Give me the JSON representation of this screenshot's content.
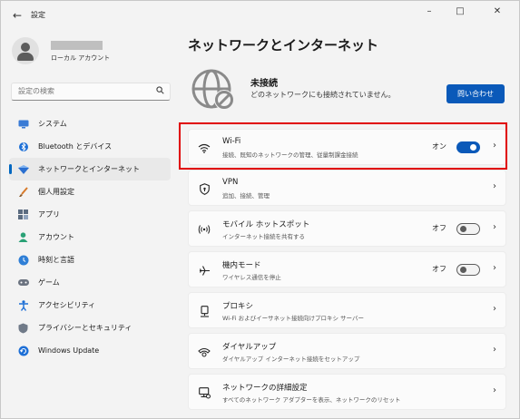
{
  "window": {
    "title": "設定",
    "back_icon": "back-arrow-icon",
    "controls": [
      "minimize",
      "maximize",
      "close"
    ]
  },
  "profile": {
    "account_type": "ローカル アカウント",
    "name_redacted": true
  },
  "search": {
    "placeholder": "設定の検索"
  },
  "sidebar": {
    "items": [
      {
        "label": "システム",
        "icon": "system-icon"
      },
      {
        "label": "Bluetooth とデバイス",
        "icon": "bluetooth-icon"
      },
      {
        "label": "ネットワークとインターネット",
        "icon": "network-icon",
        "selected": true
      },
      {
        "label": "個人用設定",
        "icon": "personalization-icon"
      },
      {
        "label": "アプリ",
        "icon": "apps-icon"
      },
      {
        "label": "アカウント",
        "icon": "account-icon"
      },
      {
        "label": "時刻と言語",
        "icon": "time-language-icon"
      },
      {
        "label": "ゲーム",
        "icon": "gaming-icon"
      },
      {
        "label": "アクセシビリティ",
        "icon": "accessibility-icon"
      },
      {
        "label": "プライバシーとセキュリティ",
        "icon": "privacy-icon"
      },
      {
        "label": "Windows Update",
        "icon": "windows-update-icon"
      }
    ]
  },
  "main": {
    "title": "ネットワークとインターネット",
    "status": {
      "title": "未接続",
      "description": "どのネットワークにも接続されていません。",
      "help_button": "問い合わせ"
    },
    "cards": [
      {
        "title": "Wi-Fi",
        "subtitle": "接続、既知のネットワークの管理、従量制課金接続",
        "toggle_label": "オン",
        "toggle": true,
        "icon": "wifi-icon"
      },
      {
        "title": "VPN",
        "subtitle": "追加、接続、管理",
        "icon": "vpn-shield-icon"
      },
      {
        "title": "モバイル ホットスポット",
        "subtitle": "インターネット接続を共有する",
        "toggle_label": "オフ",
        "toggle": false,
        "icon": "hotspot-icon"
      },
      {
        "title": "機内モード",
        "subtitle": "ワイヤレス通信を停止",
        "toggle_label": "オフ",
        "toggle": false,
        "icon": "airplane-icon"
      },
      {
        "title": "プロキシ",
        "subtitle": "Wi-Fi およびイーサネット接続向けプロキシ サーバー",
        "icon": "proxy-icon"
      },
      {
        "title": "ダイヤルアップ",
        "subtitle": "ダイヤルアップ インターネット接続をセットアップ",
        "icon": "dialup-icon"
      },
      {
        "title": "ネットワークの詳細設定",
        "subtitle": "すべてのネットワーク アダプターを表示、ネットワークのリセット",
        "icon": "advanced-network-icon"
      }
    ]
  },
  "colors": {
    "accent": "#0a59b9",
    "highlight_border": "#e00000",
    "background": "#f3f3f3"
  }
}
